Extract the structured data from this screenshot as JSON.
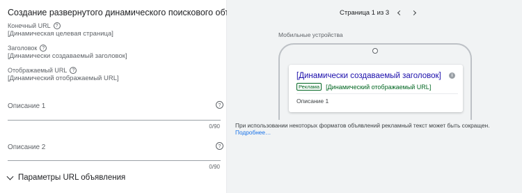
{
  "form": {
    "title": "Создание развернутого динамического поискового объявления",
    "final_url": {
      "label": "Конечный URL",
      "value": "[Динамическая целевая страница]"
    },
    "headline": {
      "label": "Заголовок",
      "value": "[Динамически создаваемый заголовок]"
    },
    "display_url": {
      "label": "Отображаемый URL",
      "value": "[Динамический отображаемый URL]"
    },
    "description1": {
      "label": "Описание 1",
      "counter": "0/90"
    },
    "description2": {
      "label": "Описание 2",
      "counter": "0/90"
    },
    "url_params": {
      "label": "Параметры URL объявления"
    },
    "help_glyph": "?"
  },
  "preview": {
    "page_indicator": "Страница 1 из 3",
    "device_label": "Мобильные устройства",
    "ad": {
      "headline": "[Динамически создаваемый заголовок]",
      "info_glyph": "i",
      "badge": "Реклама",
      "display_url": "[Динамический отображаемый URL]",
      "description": "Описание 1"
    },
    "note": "При использовании некоторых форматов объявлений рекламный текст может быть сокращен.",
    "more_link": "Подробнее…"
  }
}
